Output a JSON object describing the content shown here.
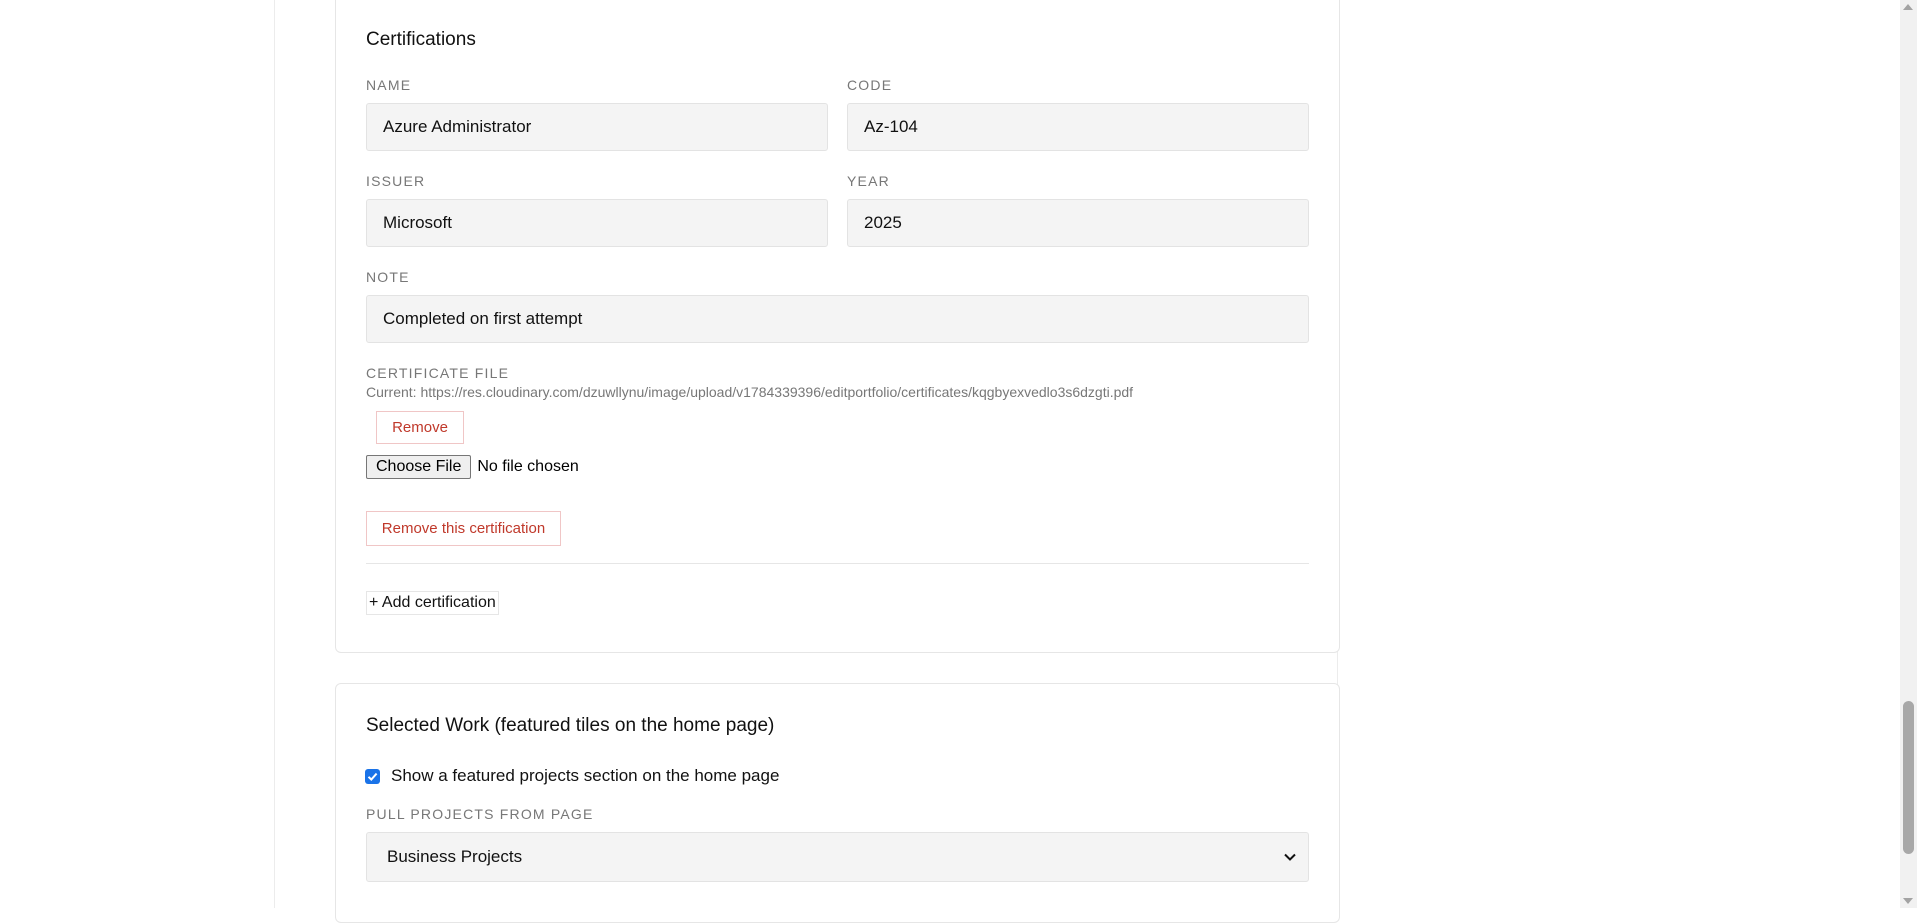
{
  "certifications": {
    "title": "Certifications",
    "name_label": "NAME",
    "name_value": "Azure Administrator",
    "code_label": "CODE",
    "code_value": "Az-104",
    "issuer_label": "ISSUER",
    "issuer_value": "Microsoft",
    "year_label": "YEAR",
    "year_value": "2025",
    "note_label": "NOTE",
    "note_value": "Completed on first attempt",
    "file_label": "CERTIFICATE FILE",
    "current_file": "Current: https://res.cloudinary.com/dzuwllynu/image/upload/v1784339396/editportfolio/certificates/kqgbyexvedlo3s6dzgti.pdf",
    "remove_file_label": "Remove",
    "choose_file_label": "Choose File",
    "no_file_text": "No file chosen",
    "remove_cert_label": "Remove this certification",
    "add_cert_label": "+ Add certification"
  },
  "selected_work": {
    "title": "Selected Work (featured tiles on the home page)",
    "show_featured_label": "Show a featured projects section on the home page",
    "show_featured_checked": true,
    "pull_label": "PULL PROJECTS FROM PAGE",
    "pull_selected": "Business Projects"
  },
  "colors": {
    "accent_blue": "#1a73e8",
    "danger_red": "#c0392b",
    "input_bg": "#f4f4f4"
  }
}
